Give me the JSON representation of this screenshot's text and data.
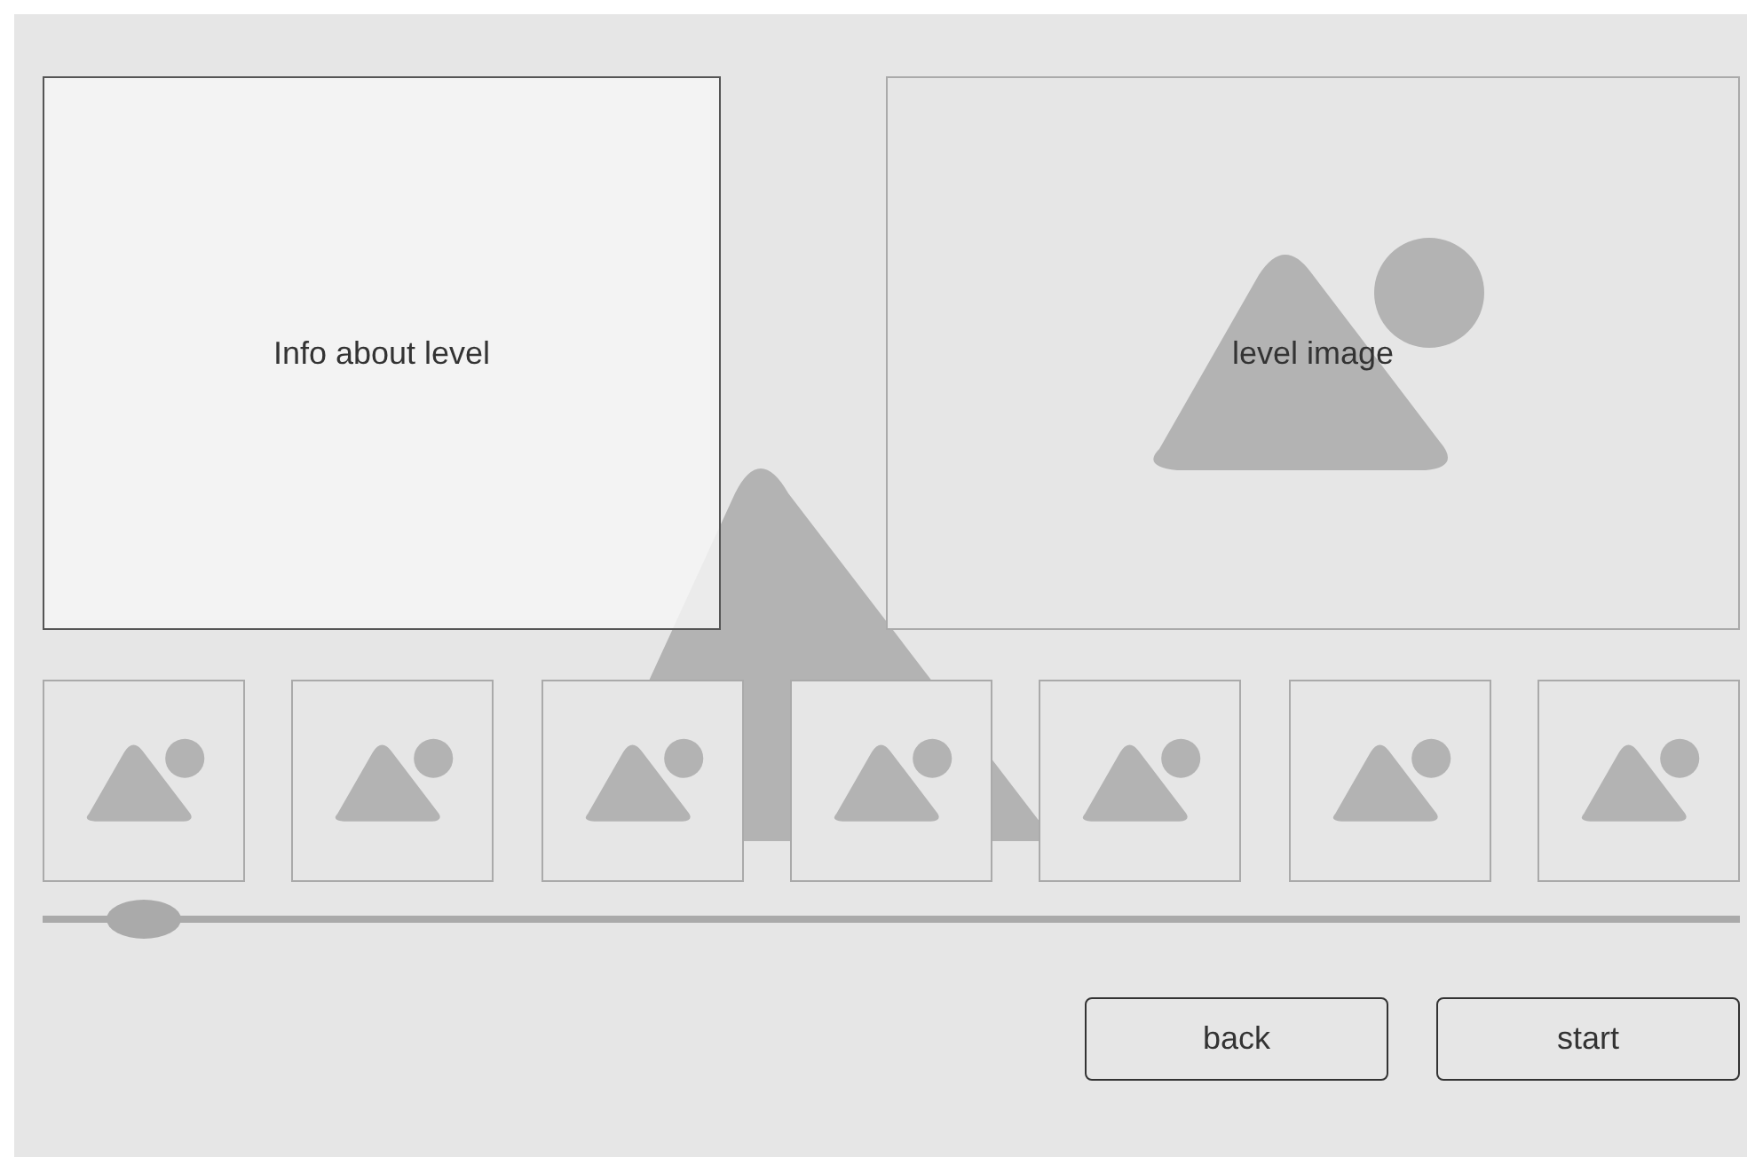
{
  "info_panel": {
    "text": "Info about level"
  },
  "level_image": {
    "kind": "picture",
    "label": "level image"
  },
  "slider": {
    "level": 0.06
  },
  "buttons": [
    "back",
    "start"
  ]
}
